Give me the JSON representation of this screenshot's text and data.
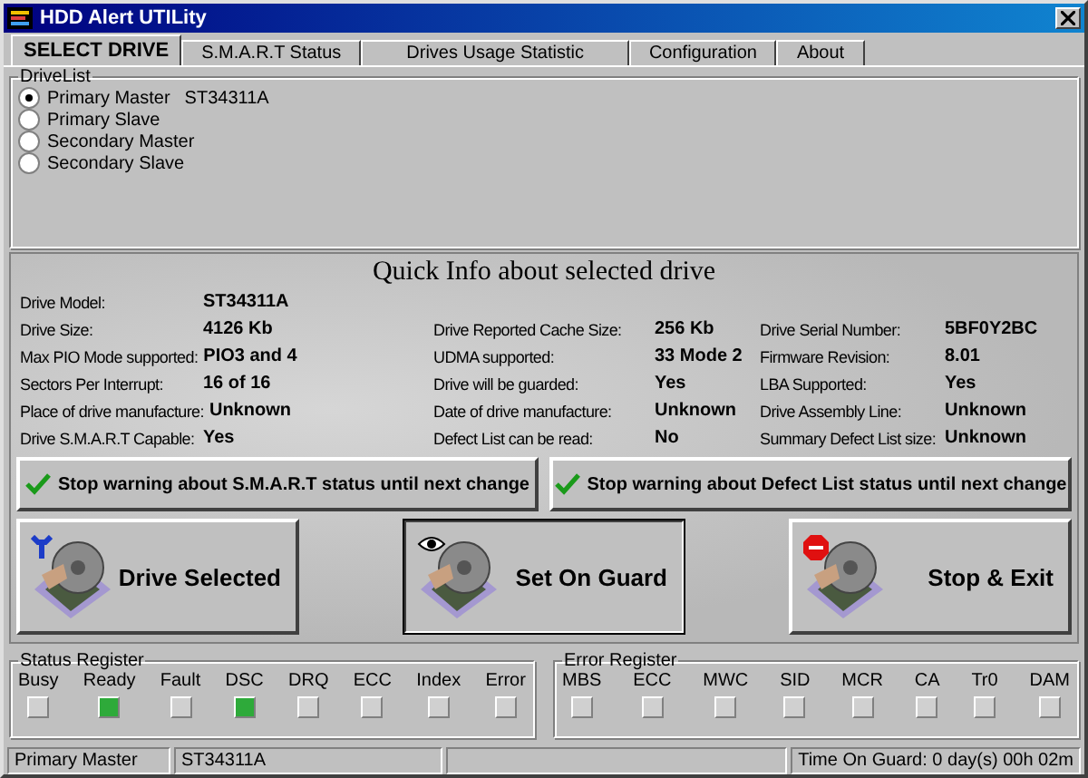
{
  "window": {
    "title": "HDD Alert UTILity"
  },
  "tabs": [
    {
      "label": "SELECT DRIVE",
      "selected": true
    },
    {
      "label": "S.M.A.R.T Status",
      "selected": false
    },
    {
      "label": "Drives Usage Statistic",
      "selected": false
    },
    {
      "label": "Configuration",
      "selected": false
    },
    {
      "label": "About",
      "selected": false
    }
  ],
  "drive_list": {
    "title": "DriveList",
    "items": [
      {
        "label": "Primary Master",
        "model": "ST34311A",
        "selected": true
      },
      {
        "label": "Primary Slave",
        "selected": false
      },
      {
        "label": "Secondary Master",
        "selected": false
      },
      {
        "label": "Secondary Slave",
        "selected": false
      }
    ]
  },
  "quick_info": {
    "title": "Quick Info about selected drive",
    "rows": [
      [
        {
          "label": "Drive Model:",
          "value": "ST34311A"
        }
      ],
      [
        {
          "label": "Drive Size:",
          "value": "4126 Kb"
        },
        {
          "label": "Drive Reported Cache Size:",
          "value": "256 Kb"
        },
        {
          "label": "Drive Serial Number:",
          "value": "5BF0Y2BC"
        }
      ],
      [
        {
          "label": "Max PIO Mode supported:",
          "value": "PIO3 and 4"
        },
        {
          "label": "UDMA supported:",
          "value": "33 Mode 2"
        },
        {
          "label": "Firmware Revision:",
          "value": "8.01"
        }
      ],
      [
        {
          "label": "Sectors Per Interrupt:",
          "value": "16 of 16"
        },
        {
          "label": "Drive will be guarded:",
          "value": "Yes"
        },
        {
          "label": "LBA Supported:",
          "value": "Yes"
        }
      ],
      [
        {
          "label": "Place of drive manufacture:",
          "value": "Unknown"
        },
        {
          "label": "Date of drive manufacture:",
          "value": "Unknown"
        },
        {
          "label": "Drive Assembly Line:",
          "value": "Unknown"
        }
      ],
      [
        {
          "label": "Drive S.M.A.R.T Capable:",
          "value": "Yes"
        },
        {
          "label": "Defect List can be read:",
          "value": "No"
        },
        {
          "label": "Summary Defect List size:",
          "value": "Unknown"
        }
      ]
    ]
  },
  "warning_buttons": [
    "Stop warning about S.M.A.R.T status until next change",
    "Stop warning about Defect List status until next change"
  ],
  "action_buttons": [
    {
      "label": "Drive Selected",
      "kind": "wrench",
      "focused": false
    },
    {
      "label": "Set On Guard",
      "kind": "eye",
      "focused": true
    },
    {
      "label": "Stop & Exit",
      "kind": "stop",
      "focused": false
    }
  ],
  "status_register": {
    "title": "Status Register",
    "flags": [
      {
        "label": "Busy",
        "on": false
      },
      {
        "label": "Ready",
        "on": true
      },
      {
        "label": "Fault",
        "on": false
      },
      {
        "label": "DSC",
        "on": true
      },
      {
        "label": "DRQ",
        "on": false
      },
      {
        "label": "ECC",
        "on": false
      },
      {
        "label": "Index",
        "on": false
      },
      {
        "label": "Error",
        "on": false
      }
    ]
  },
  "error_register": {
    "title": "Error Register",
    "flags": [
      {
        "label": "MBS",
        "on": false
      },
      {
        "label": "ECC",
        "on": false
      },
      {
        "label": "MWC",
        "on": false
      },
      {
        "label": "SID",
        "on": false
      },
      {
        "label": "MCR",
        "on": false
      },
      {
        "label": "CA",
        "on": false
      },
      {
        "label": "Tr0",
        "on": false
      },
      {
        "label": "DAM",
        "on": false
      }
    ]
  },
  "status_bar": {
    "drive": "Primary Master",
    "model": "ST34311A",
    "time_on_guard": "Time On Guard:  0 day(s) 00h 02m"
  }
}
